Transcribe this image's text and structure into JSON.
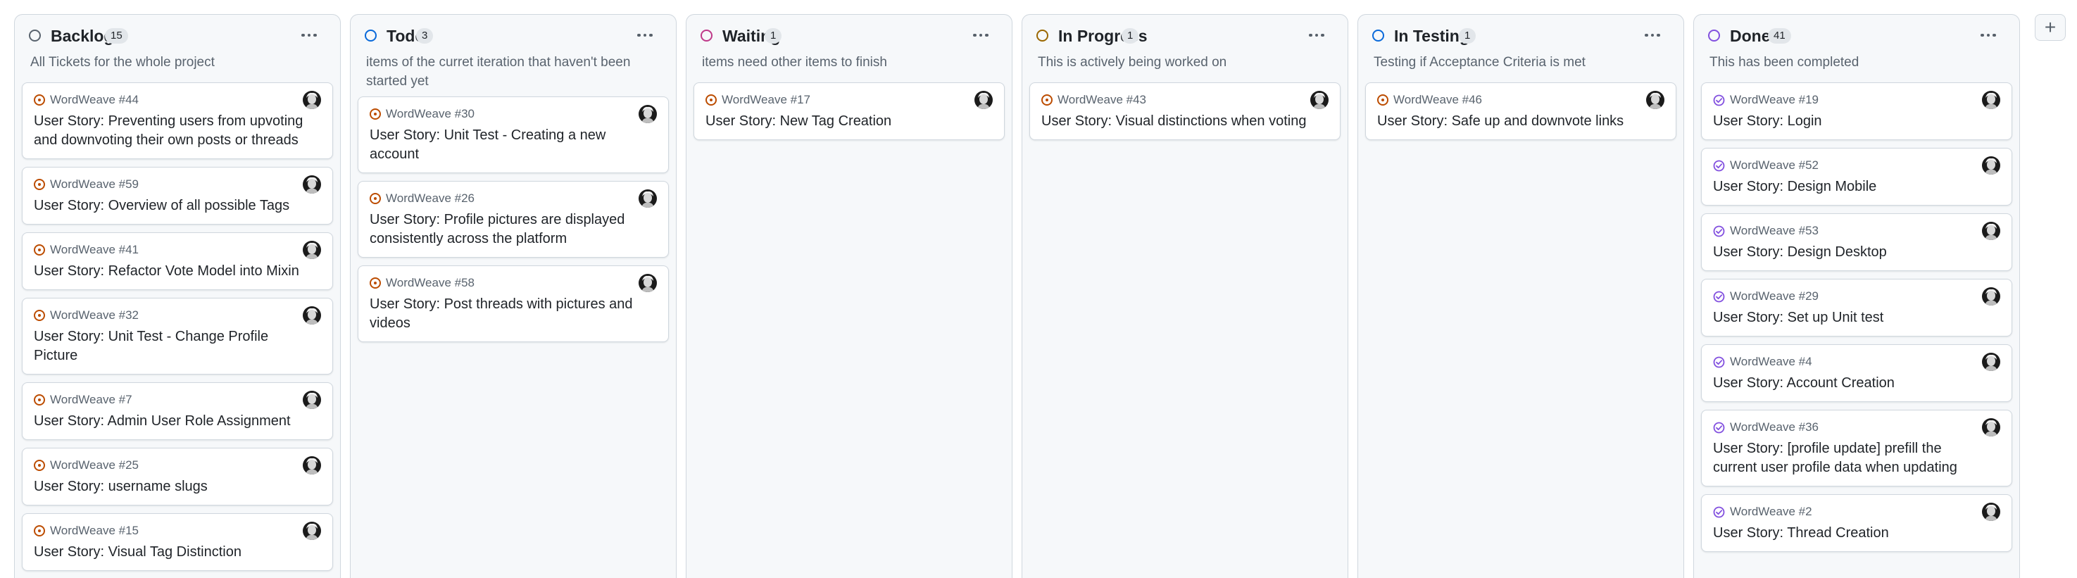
{
  "columns": [
    {
      "name": "Backlog",
      "count": "15",
      "ring_color": "#59636e",
      "description": "All Tickets for the whole project",
      "cards": [
        {
          "ref": "WordWeave #44",
          "title": "User Story: Preventing users from upvoting and downvoting their own posts or threads",
          "state": "open"
        },
        {
          "ref": "WordWeave #59",
          "title": "User Story: Overview of all possible Tags",
          "state": "open"
        },
        {
          "ref": "WordWeave #41",
          "title": "User Story: Refactor Vote Model into Mixin",
          "state": "open"
        },
        {
          "ref": "WordWeave #32",
          "title": "User Story: Unit Test - Change Profile Picture",
          "state": "open"
        },
        {
          "ref": "WordWeave #7",
          "title": "User Story: Admin User Role Assignment",
          "state": "open"
        },
        {
          "ref": "WordWeave #25",
          "title": "User Story: username slugs",
          "state": "open"
        },
        {
          "ref": "WordWeave #15",
          "title": "User Story: Visual Tag Distinction",
          "state": "open"
        }
      ]
    },
    {
      "name": "Todo",
      "count": "3",
      "ring_color": "#0969da",
      "description": "items of the curret iteration that haven't been started yet",
      "cards": [
        {
          "ref": "WordWeave #30",
          "title": "User Story: Unit Test - Creating a new account",
          "state": "open"
        },
        {
          "ref": "WordWeave #26",
          "title": "User Story: Profile pictures are displayed consistently across the platform",
          "state": "open"
        },
        {
          "ref": "WordWeave #58",
          "title": "User Story: Post threads with pictures and videos",
          "state": "open"
        }
      ]
    },
    {
      "name": "Waiting",
      "count": "1",
      "ring_color": "#bf3989",
      "description": "items need other items to finish",
      "cards": [
        {
          "ref": "WordWeave #17",
          "title": "User Story: New Tag Creation",
          "state": "open"
        }
      ]
    },
    {
      "name": "In Progress",
      "count": "1",
      "ring_color": "#9a6700",
      "description": "This is actively being worked on",
      "cards": [
        {
          "ref": "WordWeave #43",
          "title": "User Story: Visual distinctions when voting",
          "state": "open"
        }
      ]
    },
    {
      "name": "In Testing",
      "count": "1",
      "ring_color": "#0969da",
      "description": "Testing if Acceptance Criteria is met",
      "cards": [
        {
          "ref": "WordWeave #46",
          "title": "User Story: Safe up and downvote links",
          "state": "open"
        }
      ]
    },
    {
      "name": "Done",
      "count": "41",
      "ring_color": "#8250df",
      "description": "This has been completed",
      "cards": [
        {
          "ref": "WordWeave #19",
          "title": "User Story: Login",
          "state": "done"
        },
        {
          "ref": "WordWeave #52",
          "title": "User Story: Design Mobile",
          "state": "done"
        },
        {
          "ref": "WordWeave #53",
          "title": "User Story: Design Desktop",
          "state": "done"
        },
        {
          "ref": "WordWeave #29",
          "title": "User Story: Set up Unit test",
          "state": "done"
        },
        {
          "ref": "WordWeave #4",
          "title": "User Story: Account Creation",
          "state": "done"
        },
        {
          "ref": "WordWeave #36",
          "title": "User Story: [profile update] prefill the current user profile data when updating",
          "state": "done"
        },
        {
          "ref": "WordWeave #2",
          "title": "User Story: Thread Creation",
          "state": "done"
        }
      ]
    }
  ],
  "add_column_label": "+",
  "colors": {
    "open_issue": "#bc4c00",
    "closed_issue": "#8250df"
  },
  "icons": {
    "column_menu": "kebab-horizontal-icon",
    "open_card": "issue-opened-icon",
    "done_card": "issue-closed-icon"
  }
}
